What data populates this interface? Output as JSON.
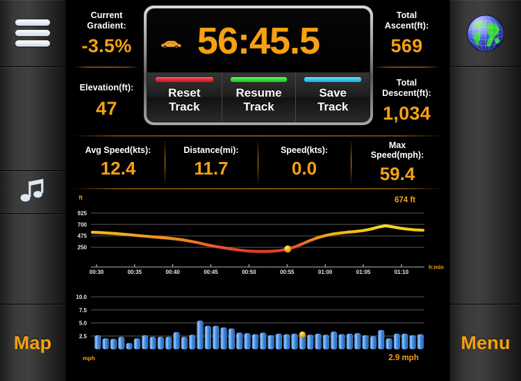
{
  "sidebar_left": {
    "menu_icon": "hamburger-menu-icon",
    "music_icon": "music-note-icon",
    "map_label": "Map"
  },
  "sidebar_right": {
    "globe_icon": "globe-icon",
    "menu_label": "Menu"
  },
  "stats_left": [
    {
      "label": "Current\nGradient:",
      "label_line1": "Current",
      "label_line2": "Gradient:",
      "value": "-3.5%"
    },
    {
      "label": "Elevation(ft):",
      "label_line1": "Elevation(ft):",
      "label_line2": "",
      "value": "47"
    }
  ],
  "stats_right": [
    {
      "label_line1": "Total",
      "label_line2": "Ascent(ft):",
      "value": "569"
    },
    {
      "label_line1": "Total",
      "label_line2": "Descent(ft):",
      "value": "1,034"
    }
  ],
  "timer": {
    "elapsed": "56:45.5",
    "car_icon": "car-icon",
    "buttons": [
      {
        "line1": "Reset",
        "line2": "Track",
        "color": "#e8212f"
      },
      {
        "line1": "Resume",
        "line2": "Track",
        "color": "#2ee02e"
      },
      {
        "line1": "Save",
        "line2": "Track",
        "color": "#2bc3ef"
      }
    ]
  },
  "mid_stats": [
    {
      "label_line1": "Avg Speed(kts):",
      "label_line2": "",
      "value": "12.4"
    },
    {
      "label_line1": "Distance(mi):",
      "label_line2": "",
      "value": "11.7"
    },
    {
      "label_line1": "Speed(kts):",
      "label_line2": "",
      "value": "0.0"
    },
    {
      "label_line1": "Max",
      "label_line2": "Speed(mph):",
      "value": "59.4"
    }
  ],
  "chart_data": [
    {
      "type": "line",
      "name": "elevation-profile",
      "title": "",
      "ylabel": "ft",
      "xlabel": "h:min",
      "annotation": "674 ft",
      "ylim": [
        25,
        1150
      ],
      "yticks": [
        925,
        700,
        475,
        250
      ],
      "xticks": [
        "00:30",
        "00:35",
        "00:40",
        "00:45",
        "00:50",
        "00:55",
        "01:00",
        "01:05",
        "01:10"
      ],
      "grid": true,
      "marker": {
        "x_index": 26,
        "label": "674 ft"
      },
      "x": [
        0,
        1,
        2,
        3,
        4,
        5,
        6,
        7,
        8,
        9,
        10,
        11,
        12,
        13,
        14,
        15,
        16,
        17,
        18,
        19,
        20,
        21,
        22,
        23,
        24,
        25,
        26,
        27,
        28,
        29,
        30,
        31,
        32,
        33,
        34,
        35,
        36,
        37,
        38,
        39,
        40,
        41,
        42,
        43,
        44
      ],
      "values": [
        545,
        540,
        530,
        520,
        508,
        495,
        480,
        468,
        455,
        442,
        430,
        415,
        395,
        370,
        340,
        305,
        275,
        250,
        225,
        205,
        185,
        172,
        168,
        168,
        172,
        185,
        215,
        260,
        320,
        385,
        440,
        480,
        510,
        530,
        548,
        560,
        578,
        605,
        645,
        674,
        650,
        625,
        605,
        592,
        585
      ]
    },
    {
      "type": "bar",
      "name": "speed-profile",
      "title": "",
      "ylabel": "mph",
      "xlabel": "",
      "annotation": "2.9 mph",
      "ylim": [
        0,
        11.2
      ],
      "yticks": [
        10.0,
        7.5,
        5.0,
        2.5
      ],
      "xticks": [
        "00:30",
        "00:35",
        "00:40",
        "00:45",
        "00:50",
        "00:55",
        "01:00",
        "01:05",
        "01:10"
      ],
      "grid": true,
      "marker": {
        "x_index": 26,
        "label": "2.9 mph"
      },
      "values": [
        2.6,
        2.0,
        1.9,
        2.3,
        1.1,
        2.0,
        2.6,
        2.3,
        2.3,
        2.3,
        3.2,
        2.3,
        2.7,
        5.4,
        4.4,
        4.4,
        4.1,
        3.9,
        3.1,
        3.0,
        2.8,
        3.1,
        2.6,
        2.9,
        2.8,
        2.9,
        2.9,
        2.7,
        2.9,
        2.7,
        3.3,
        2.8,
        2.9,
        3.0,
        2.6,
        2.4,
        3.6,
        2.0,
        2.9,
        2.9,
        2.6,
        2.8
      ]
    }
  ]
}
